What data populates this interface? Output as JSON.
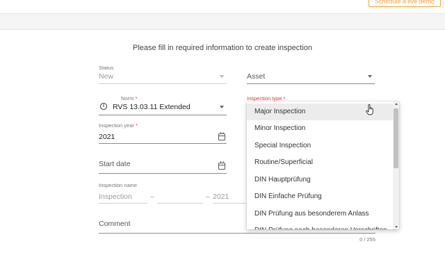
{
  "header": {
    "demo_button": "Schedule a live demo"
  },
  "intro": "Please fill in required information to create inspection",
  "form": {
    "status": {
      "label": "Status",
      "value": "New"
    },
    "asset": {
      "placeholder": "Asset"
    },
    "norm": {
      "label": "Norm",
      "required_mark": "*",
      "value": "RVS 13.03.11 Extended"
    },
    "inspection_type": {
      "label": "Inspection type",
      "required_mark": "*"
    },
    "inspection_year": {
      "label": "Inspection year",
      "required_mark": "*",
      "value": "2021"
    },
    "start_date": {
      "placeholder": "Start date"
    },
    "inspection_name": {
      "label": "Inspection name",
      "part1": "Inspection",
      "separator1": "–",
      "separator2": "–",
      "year": "2021"
    },
    "comment": {
      "placeholder": "Comment",
      "counter": "0 / 255"
    }
  },
  "dropdown": {
    "options": [
      "Major Inspection",
      "Minor Inspection",
      "Special Inspection",
      "Routine/Superficial",
      "DIN Hauptprüfung",
      "DIN Einfache Prüfung",
      "DIN Prüfung aus besonderem Anlass",
      "DIN Prüfung nach besonderen Vorschriften"
    ],
    "highlighted_index": 0
  },
  "icons": {
    "calendar": "calendar-icon",
    "info": "info-icon",
    "dropdown": "chevron-down-icon",
    "cursor": "hand-pointer-cursor"
  },
  "colors": {
    "accent": "#f2a33a",
    "required": "#e53935",
    "highlight": "#ececec"
  }
}
